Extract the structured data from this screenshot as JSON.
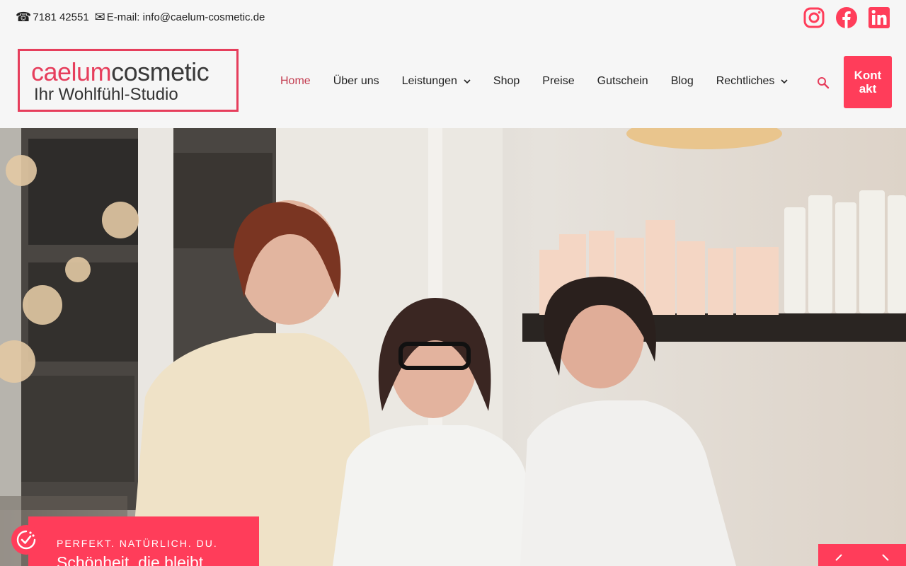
{
  "topbar": {
    "phone_icon": "phone-icon",
    "phone": "7181 42551",
    "mail_icon": "envelope-icon",
    "email": "E-mail: info@caelum-cosmetic.de",
    "social": [
      "instagram-icon",
      "facebook-icon",
      "linkedin-icon"
    ]
  },
  "logo": {
    "word1": "caelum",
    "word2": "cosmetic",
    "tagline": "Ihr Wohlfühl-Studio"
  },
  "nav": {
    "items": [
      {
        "label": "Home",
        "active": true
      },
      {
        "label": "Über uns"
      },
      {
        "label": "Leistungen",
        "dropdown": true
      },
      {
        "label": "Shop"
      },
      {
        "label": "Preise"
      },
      {
        "label": "Gutschein"
      },
      {
        "label": "Blog"
      },
      {
        "label": "Rechtliches",
        "dropdown": true
      }
    ],
    "search_icon": "search-icon",
    "cta": "Kontakt"
  },
  "hero": {
    "kicker": "PERFEKT. NATÜRLICH. DU.",
    "headline": "Schönheit, die bleibt",
    "arrows": [
      "chevron-left-icon",
      "chevron-right-icon"
    ]
  },
  "colors": {
    "accent": "#ff3d5a",
    "logo_red": "#e63e5c",
    "active_nav": "#c23a4e",
    "background": "#f6f6f6"
  }
}
